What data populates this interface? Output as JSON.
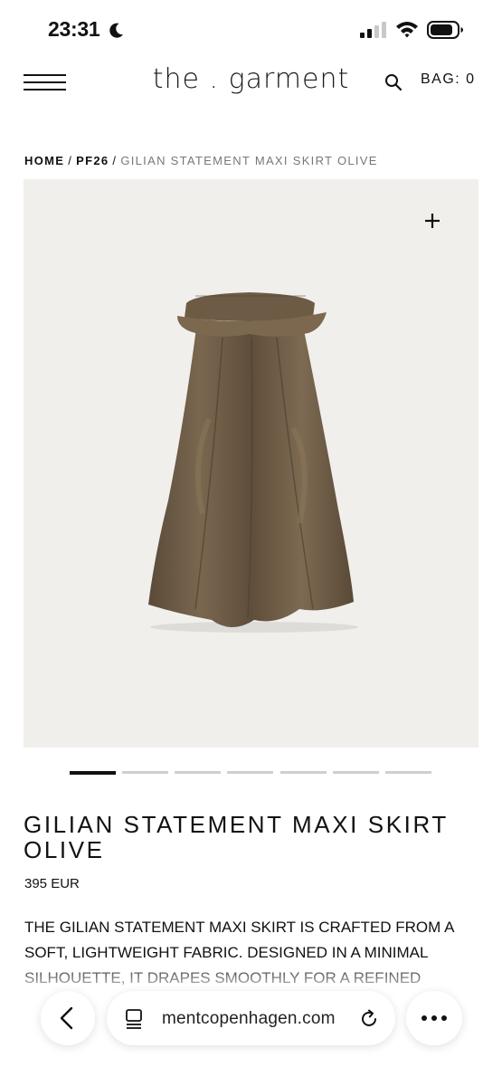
{
  "status_bar": {
    "time": "23:31",
    "icons": [
      "moon-icon",
      "cellular-signal-icon",
      "wifi-icon",
      "battery-icon"
    ]
  },
  "header": {
    "logo": "the . garment",
    "bag_label": "BAG: 0",
    "icons": [
      "hamburger-menu-icon",
      "search-icon"
    ]
  },
  "breadcrumb": {
    "items": [
      "HOME",
      "PF26"
    ],
    "separator": "/",
    "current": "GILIAN STATEMENT MAXI SKIRT OLIVE"
  },
  "gallery": {
    "zoom_icon": "plus-icon",
    "image_subject": "olive-skirt-image",
    "slide_count": 7,
    "active_slide": 1
  },
  "product": {
    "title": "GILIAN STATEMENT MAXI SKIRT OLIVE",
    "price": "395 EUR",
    "description": "THE GILIAN STATEMENT MAXI SKIRT IS CRAFTED FROM A SOFT, LIGHTWEIGHT FABRIC. DESIGNED IN A MINIMAL SILHOUETTE, IT DRAPES SMOOTHLY FOR A REFINED"
  },
  "browser": {
    "url": "mentcopenhagen.com",
    "icons": [
      "back-chevron-icon",
      "tabs-icon",
      "reload-icon",
      "more-icon"
    ]
  },
  "colors": {
    "text": "#111111",
    "muted": "#777777",
    "image_background": "#f0efec",
    "skirt": "#6b5a45",
    "pager_inactive": "#cfcfcf"
  }
}
